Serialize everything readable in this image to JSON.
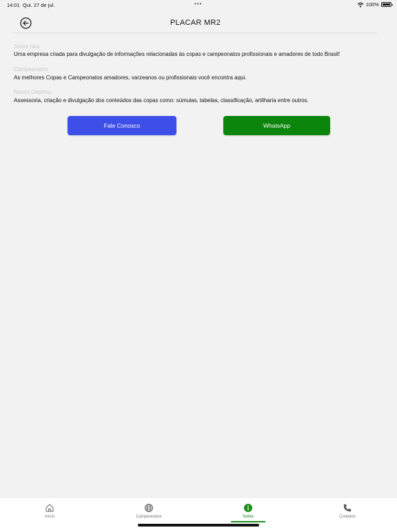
{
  "status_bar": {
    "time": "14:01",
    "date": "Qui. 27 de jul.",
    "dots": "•••",
    "battery": "100%"
  },
  "header": {
    "title": "PLACAR MR2"
  },
  "sections": [
    {
      "label": "Sobre Nós",
      "text": "Uma empresa criada para divulgação de informações relacionadas às copas e campeonatos profissionais e amadores de todo Brasil!"
    },
    {
      "label": "Campeonatos",
      "text": "As melhores Copas e Campeonatos amadores, varzeanos ou profissionais você encontra aqui."
    },
    {
      "label": "Nosso Objetivo",
      "text": "Assessoria, criação e divulgação dos conteúdos das copas como: súmulas, tabelas, classificação, artilharia entre outros."
    }
  ],
  "buttons": {
    "contact_label": "Fale Conosco",
    "contact_color": "#3d4fe8",
    "whatsapp_label": "WhatsApp",
    "whatsapp_color": "#0b850b"
  },
  "nav": {
    "items": [
      {
        "label": "Início",
        "icon": "home-icon"
      },
      {
        "label": "Campeonatos",
        "icon": "globe-icon"
      },
      {
        "label": "Sobre",
        "icon": "info-icon",
        "active": true
      },
      {
        "label": "Contatos",
        "icon": "phone-icon"
      }
    ],
    "active_color": "#1a8f1a"
  }
}
